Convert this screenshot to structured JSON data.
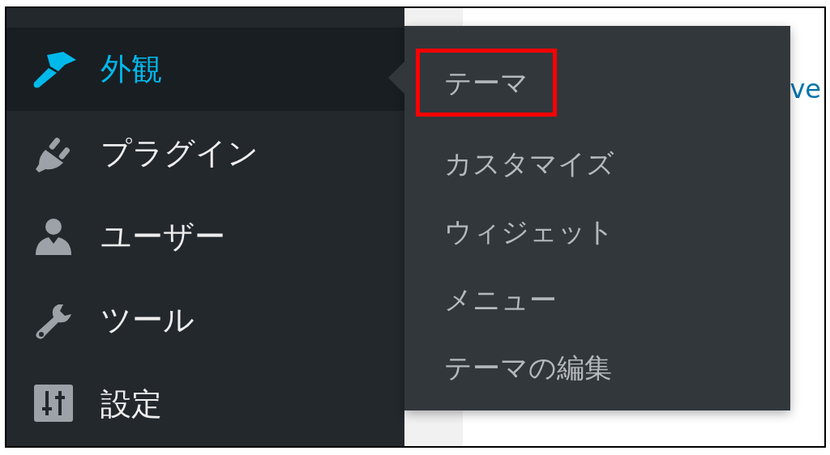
{
  "sidebar": {
    "items": [
      {
        "label": "外観",
        "selected": true
      },
      {
        "label": "プラグイン",
        "selected": false
      },
      {
        "label": "ユーザー",
        "selected": false
      },
      {
        "label": "ツール",
        "selected": false
      },
      {
        "label": "設定",
        "selected": false
      }
    ]
  },
  "flyout": {
    "items": [
      {
        "label": "テーマ",
        "highlighted": true
      },
      {
        "label": "カスタマイズ",
        "highlighted": false
      },
      {
        "label": "ウィジェット",
        "highlighted": false
      },
      {
        "label": "メニュー",
        "highlighted": false
      },
      {
        "label": "テーマの編集",
        "highlighted": false
      }
    ]
  },
  "content": {
    "link_fragment": "ve"
  }
}
